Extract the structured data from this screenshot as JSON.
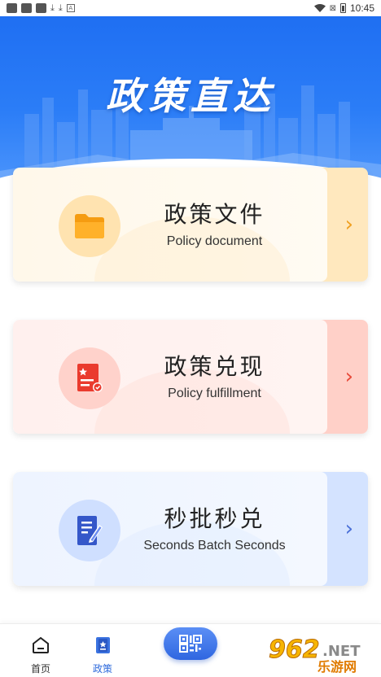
{
  "status_bar": {
    "time": "10:45",
    "icons": [
      "notification-icon",
      "notification-icon",
      "notification-icon",
      "download-icon",
      "download-icon",
      "font-icon",
      "wifi-icon",
      "no-sim-icon",
      "battery-icon"
    ]
  },
  "banner": {
    "title": "政策直达",
    "colors": {
      "top": "#1f6ff2",
      "bottom": "#4c95fb"
    }
  },
  "cards": [
    {
      "title": "政策文件",
      "subtitle": "Policy document",
      "icon": "folder-icon",
      "accent": "#f0a020"
    },
    {
      "title": "政策兑现",
      "subtitle": "Policy fulfillment",
      "icon": "certificate-icon",
      "accent": "#e84a3a"
    },
    {
      "title": "秒批秒兑",
      "subtitle": "Seconds Batch Seconds",
      "icon": "sign-document-icon",
      "accent": "#4a70d8"
    }
  ],
  "bottom_nav": {
    "items": [
      {
        "label": "首页",
        "icon": "home-icon",
        "active": false
      },
      {
        "label": "政策",
        "icon": "policy-icon",
        "active": true
      }
    ],
    "center_button_icon": "qr-scan-icon",
    "active_color": "#2f6bdc"
  },
  "watermark": {
    "number": "962",
    "suffix": ".NET",
    "chinese": "乐游网"
  }
}
